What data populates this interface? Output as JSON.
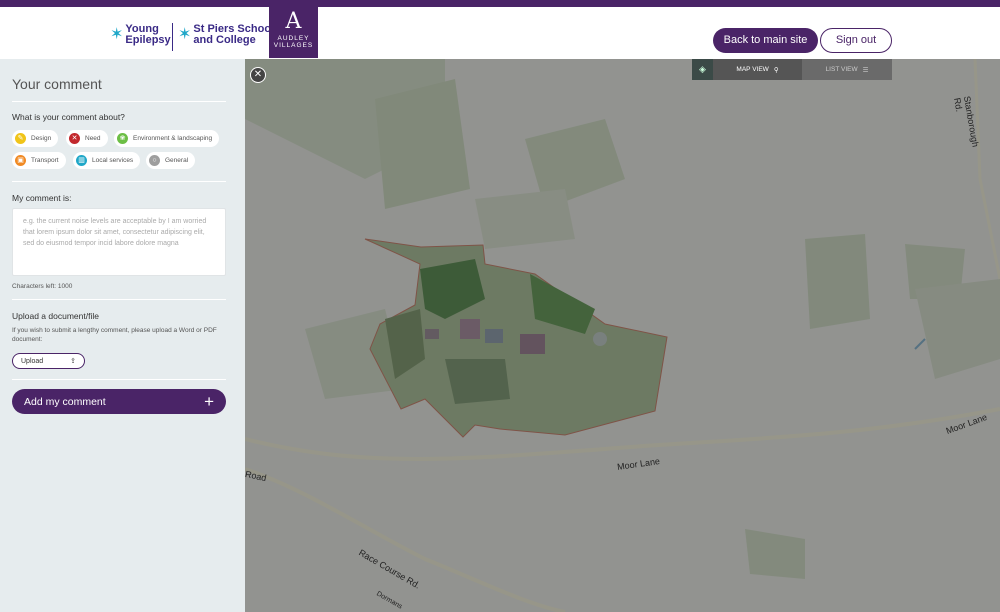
{
  "header": {
    "logo_young_epilepsy": [
      "Young",
      "Epilepsy"
    ],
    "logo_st_piers": [
      "St Piers School",
      "and College"
    ],
    "logo_audley": {
      "letter": "A",
      "line1": "AUDLEY",
      "line2": "VILLAGES"
    },
    "back_button": "Back to main site",
    "signout_button": "Sign out"
  },
  "sidebar": {
    "title": "Your comment",
    "about_label": "What is your comment about?",
    "categories": [
      {
        "label": "Design",
        "color": "#f0c419",
        "icon": "pencil-icon"
      },
      {
        "label": "Need",
        "color": "#c2282d",
        "icon": "need-icon"
      },
      {
        "label": "Environment & landscaping",
        "color": "#6cbe45",
        "icon": "leaf-icon"
      },
      {
        "label": "Transport",
        "color": "#f08a24",
        "icon": "car-icon"
      },
      {
        "label": "Local services",
        "color": "#1fa7c8",
        "icon": "services-icon"
      },
      {
        "label": "General",
        "color": "#9e9e9e",
        "icon": "general-icon"
      }
    ],
    "comment_label": "My comment is:",
    "comment_placeholder": "e.g. the current noise levels are acceptable by I am worried that lorem ipsum dolor sit amet, consectetur adipiscing elit, sed do eiusmod tempor incid labore dolore magna",
    "chars_left": "Characters left: 1000",
    "upload_title": "Upload a document/file",
    "upload_hint": "If you wish to submit a lengthy comment, please upload a Word or PDF document:",
    "upload_button": "Upload",
    "add_button": "Add my comment"
  },
  "map": {
    "toggle": {
      "map_view": "MAP VIEW",
      "list_view": "LIST VIEW"
    },
    "road_labels": [
      "Moor Lane",
      "Moor Lane",
      "Race Course Rd.",
      "Road",
      "Stanborough Rd.",
      "Dormans"
    ]
  }
}
